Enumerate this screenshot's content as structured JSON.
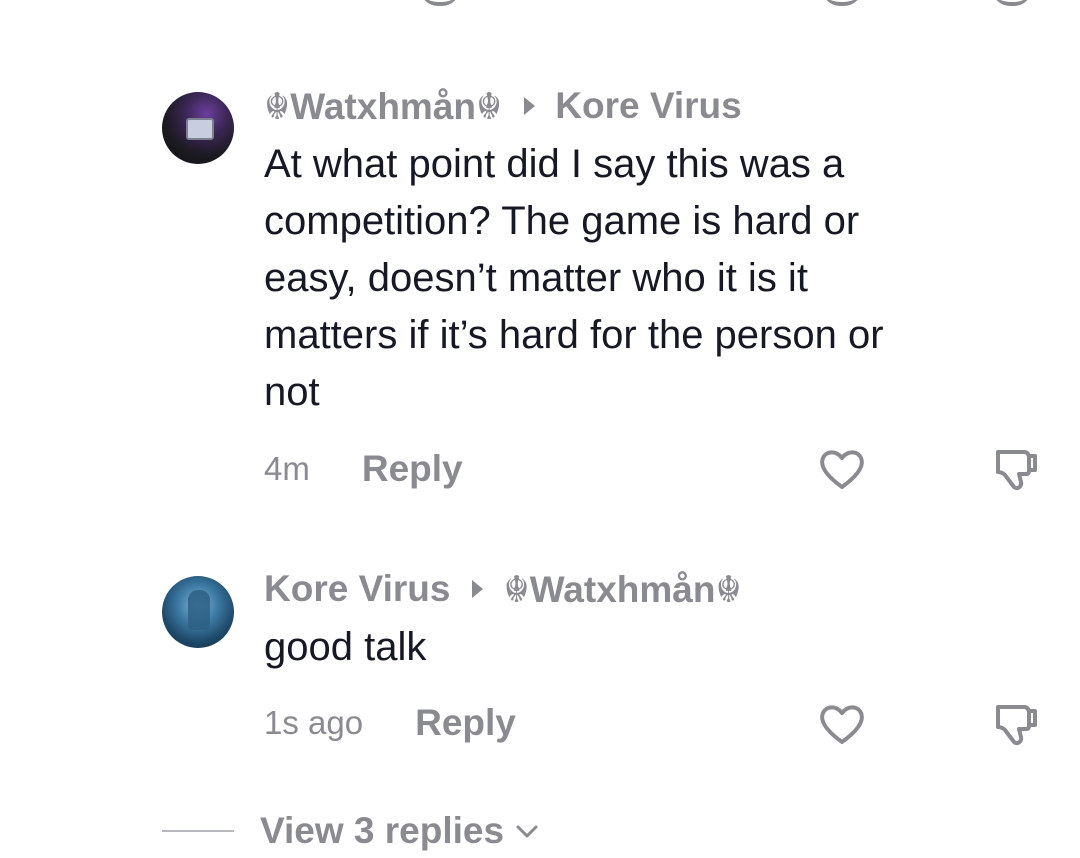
{
  "comments": [
    {
      "author": "☬Watxhmån☬",
      "reply_to": "Kore Virus",
      "text": "At what point did I say this was a\ncompetition? The game is hard or\neasy, doesn’t matter who it is it\nmatters if it’s hard for the person or\nnot",
      "time": "4m",
      "reply_label": "Reply"
    },
    {
      "author": "Kore Virus",
      "reply_to": "☬Watxhmån☬",
      "text": "good talk",
      "time": "1s ago",
      "reply_label": "Reply"
    }
  ],
  "view_replies_label": "View 3 replies",
  "icons": {
    "like": "heart-outline-icon",
    "dislike": "thumbs-down-icon",
    "expand": "chevron-down-icon",
    "arrow": "play-arrow-icon"
  },
  "colors": {
    "primary_text": "#161823",
    "secondary_text": "#8a8b91",
    "background": "#ffffff"
  }
}
